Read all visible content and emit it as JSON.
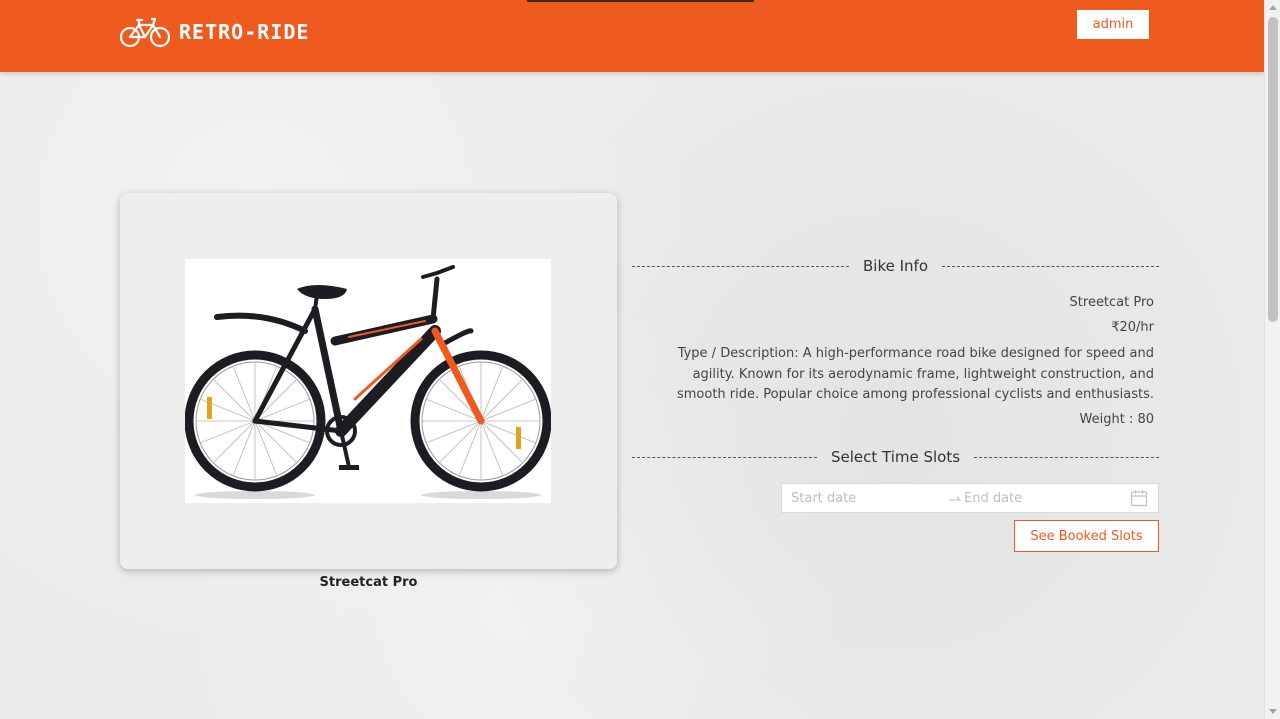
{
  "header": {
    "brand_name": "RETRO-RIDE",
    "brand_icon": "bicycle-icon",
    "user_button_label": "admin",
    "accent_color": "#ef5a1f"
  },
  "bike": {
    "card_caption": "Streetcat Pro",
    "image_alt": "bicycle-photo"
  },
  "bike_info": {
    "heading": "Bike Info",
    "name": "Streetcat Pro",
    "price": "₹20/hr",
    "description": "Type / Description: A high-performance road bike designed for speed and agility. Known for its aerodynamic frame, lightweight construction, and smooth ride. Popular choice among professional cyclists and enthusiasts.",
    "weight": "Weight : 80"
  },
  "time_slots": {
    "heading": "Select Time Slots",
    "start_placeholder": "Start date",
    "end_placeholder": "End date",
    "separator_icon": "arrow-right-icon",
    "calendar_icon": "calendar-icon",
    "booked_button_label": "See Booked Slots"
  }
}
